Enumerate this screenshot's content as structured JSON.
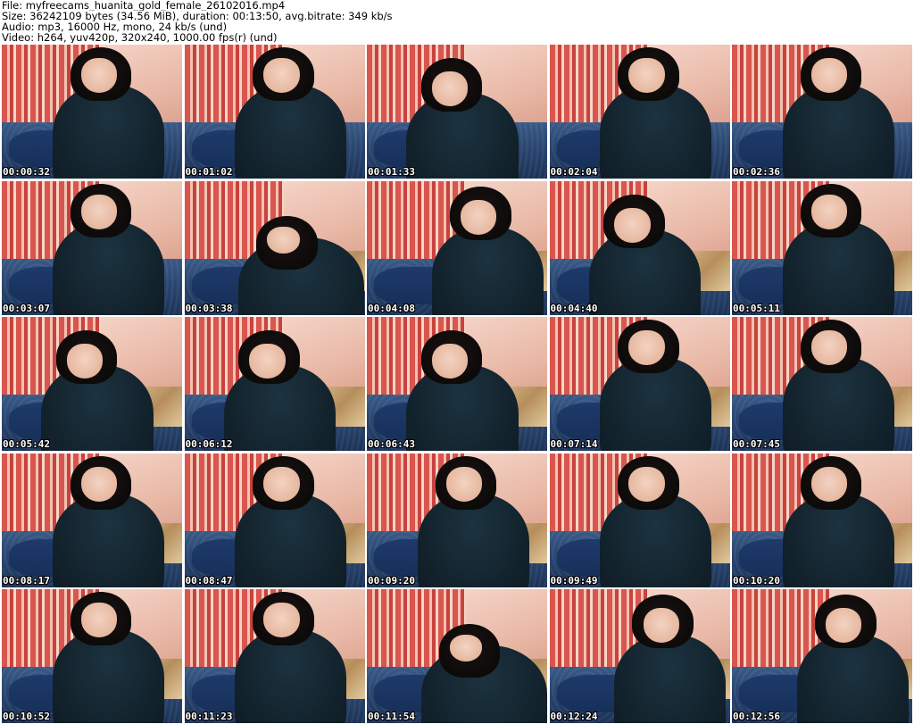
{
  "header": {
    "file_line": "File: myfreecams_huanita_gold_female_26102016.mp4",
    "size_line": "Size: 36242109 bytes (34.56 MiB), duration: 00:13:50, avg.bitrate: 349 kb/s",
    "audio_line": "Audio: mp3, 16000 Hz, mono, 24 kb/s (und)",
    "video_line": "Video: h264, yuv420p, 320x240, 1000.00 fps(r) (und)"
  },
  "thumbnails": [
    {
      "timestamp": "00:00:32"
    },
    {
      "timestamp": "00:01:02"
    },
    {
      "timestamp": "00:01:33"
    },
    {
      "timestamp": "00:02:04"
    },
    {
      "timestamp": "00:02:36"
    },
    {
      "timestamp": "00:03:07"
    },
    {
      "timestamp": "00:03:38"
    },
    {
      "timestamp": "00:04:08"
    },
    {
      "timestamp": "00:04:40"
    },
    {
      "timestamp": "00:05:11"
    },
    {
      "timestamp": "00:05:42"
    },
    {
      "timestamp": "00:06:12"
    },
    {
      "timestamp": "00:06:43"
    },
    {
      "timestamp": "00:07:14"
    },
    {
      "timestamp": "00:07:45"
    },
    {
      "timestamp": "00:08:17"
    },
    {
      "timestamp": "00:08:47"
    },
    {
      "timestamp": "00:09:20"
    },
    {
      "timestamp": "00:09:49"
    },
    {
      "timestamp": "00:10:20"
    },
    {
      "timestamp": "00:10:52"
    },
    {
      "timestamp": "00:11:23"
    },
    {
      "timestamp": "00:11:54"
    },
    {
      "timestamp": "00:12:24"
    },
    {
      "timestamp": "00:12:56"
    }
  ]
}
